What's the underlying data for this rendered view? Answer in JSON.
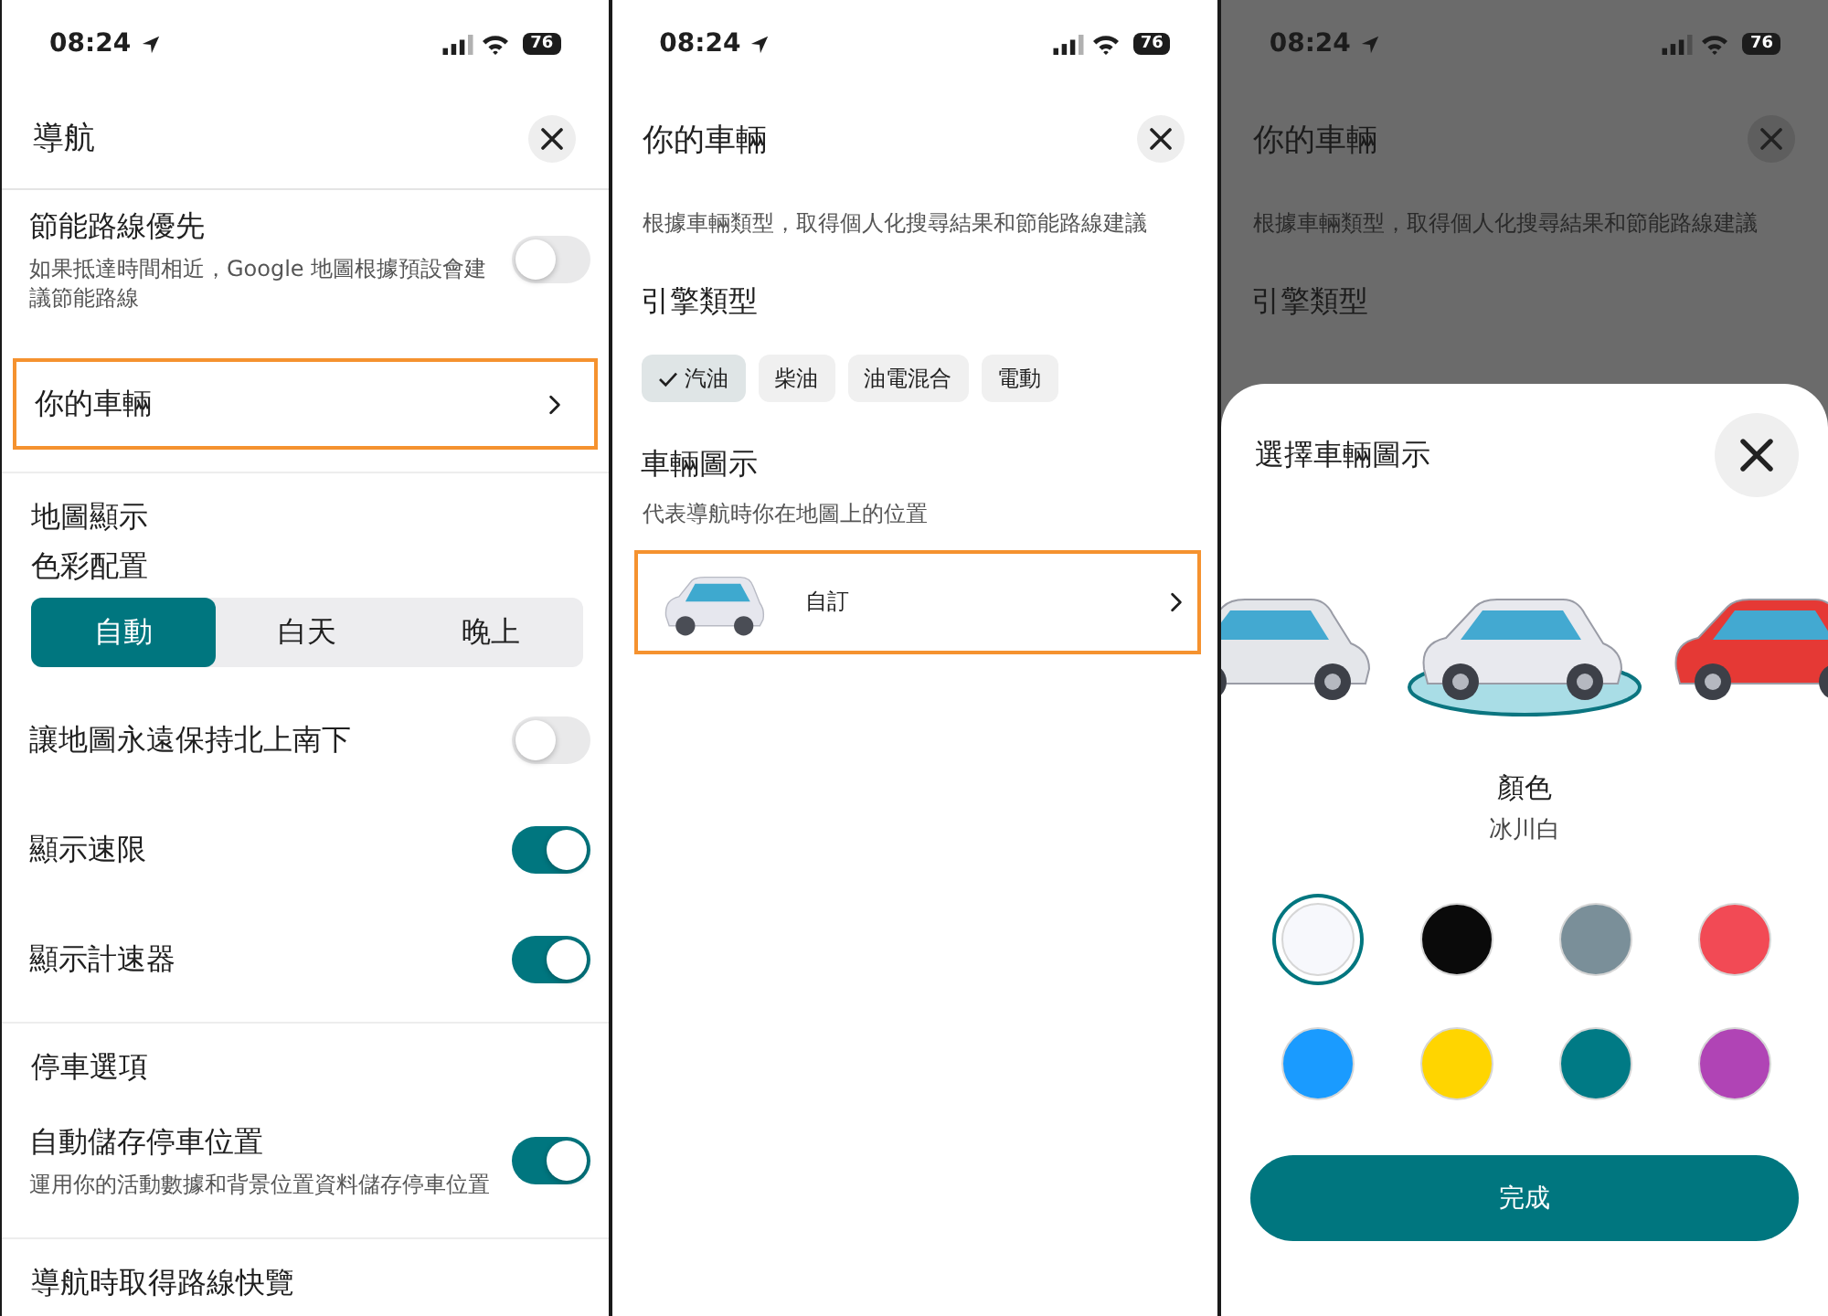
{
  "navigation_settings": {
    "status_bar": {
      "time": "08:24",
      "battery": "76"
    },
    "title": "導航",
    "groups": [
      {
        "items": [
          {
            "kind": "toggle",
            "label": "節能路線優先",
            "description": "如果抵達時間相近，Google 地圖根據預設會建議節能路線",
            "on": false
          }
        ]
      },
      {
        "items": [
          {
            "kind": "link",
            "label": "你的車輛",
            "highlighted": true
          }
        ]
      },
      {
        "items": [
          {
            "kind": "heading",
            "label": "地圖顯示"
          },
          {
            "kind": "subheading",
            "label": "色彩配置"
          },
          {
            "kind": "segmented",
            "options": [
              {
                "label": "自動",
                "selected": true
              },
              {
                "label": "白天",
                "selected": false
              },
              {
                "label": "晚上",
                "selected": false
              }
            ]
          },
          {
            "kind": "toggle",
            "label": "讓地圖永遠保持北上南下",
            "on": false
          },
          {
            "kind": "toggle",
            "label": "顯示速限",
            "on": true
          },
          {
            "kind": "toggle",
            "label": "顯示計速器",
            "on": true
          }
        ]
      },
      {
        "items": [
          {
            "kind": "heading",
            "label": "停車選項"
          },
          {
            "kind": "toggle",
            "label": "自動儲存停車位置",
            "description": "運用你的活動數據和背景位置資料儲存停車位置",
            "on": true
          }
        ]
      },
      {
        "items": [
          {
            "kind": "heading",
            "label": "導航時取得路線快覽"
          }
        ]
      }
    ]
  },
  "vehicle_settings": {
    "status_bar": {
      "time": "08:24",
      "battery": "76"
    },
    "title": "你的車輛",
    "description": "根據車輛類型，取得個人化搜尋結果和節能路線建議",
    "engine_type": {
      "heading": "引擎類型",
      "options": [
        {
          "label": "汽油",
          "selected": true
        },
        {
          "label": "柴油",
          "selected": false
        },
        {
          "label": "油電混合",
          "selected": false
        },
        {
          "label": "電動",
          "selected": false
        }
      ]
    },
    "vehicle_icon": {
      "heading": "車輛圖示",
      "description": "代表導航時你在地圖上的位置",
      "current": {
        "label": "自訂",
        "highlighted": true
      }
    }
  },
  "vehicle_icon_picker": {
    "background": {
      "status_bar": {
        "time": "08:24",
        "battery": "76"
      },
      "title": "你的車輛",
      "description": "根據車輛類型，取得個人化搜尋結果和節能路線建議",
      "heading": "引擎類型"
    },
    "sheet": {
      "title": "選擇車輛圖示",
      "cars": [
        {
          "color": "#e4e6ea",
          "selected": false
        },
        {
          "color": "#e8e9ee",
          "selected": true
        },
        {
          "color": "#e53935",
          "selected": false
        }
      ],
      "color_heading": "顏色",
      "color_name": "冰川白",
      "swatches": [
        {
          "color": "#f7f8fc",
          "selected": true
        },
        {
          "color": "#0a0a0a",
          "selected": false
        },
        {
          "color": "#7a8f99",
          "selected": false
        },
        {
          "color": "#f24a55",
          "selected": false
        },
        {
          "color": "#1a9bff",
          "selected": false
        },
        {
          "color": "#ffd500",
          "selected": false
        },
        {
          "color": "#007a85",
          "selected": false
        },
        {
          "color": "#b044b5",
          "selected": false
        }
      ],
      "done_button": "完成"
    }
  }
}
